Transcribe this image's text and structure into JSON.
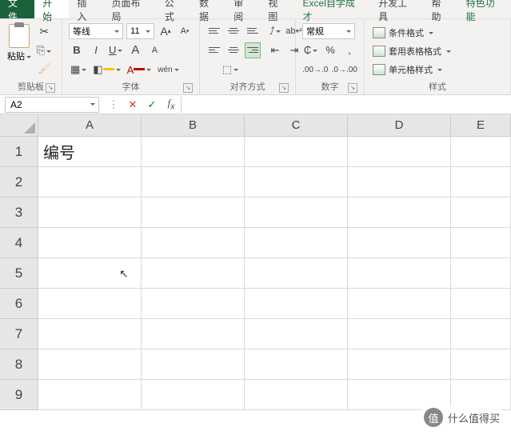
{
  "tabs": {
    "file": "文件",
    "home": "开始",
    "insert": "插入",
    "layout": "页面布局",
    "formulas": "公式",
    "data": "数据",
    "review": "审阅",
    "view": "视图",
    "excel": "Excel自学成才",
    "dev": "开发工具",
    "help": "帮助",
    "special": "特色功能"
  },
  "clipboard": {
    "paste": "粘贴",
    "group": "剪贴板"
  },
  "font": {
    "name": "等线",
    "size": "11",
    "bold": "B",
    "italic": "I",
    "underline": "U",
    "grow": "A",
    "shrink": "A",
    "phonetic": "wén",
    "group": "字体"
  },
  "align": {
    "wrap": "ab",
    "group": "对齐方式"
  },
  "number": {
    "format": "常规",
    "group": "数字"
  },
  "styles": {
    "cond": "条件格式",
    "table": "套用表格格式",
    "cell": "单元格样式",
    "group": "样式"
  },
  "namebox": "A2",
  "cols": [
    "A",
    "B",
    "C",
    "D",
    "E"
  ],
  "rows": [
    "1",
    "2",
    "3",
    "4",
    "5",
    "6",
    "7",
    "8",
    "9"
  ],
  "cellA1": "编号",
  "watermark": {
    "badge": "值",
    "text": "什么值得买"
  }
}
